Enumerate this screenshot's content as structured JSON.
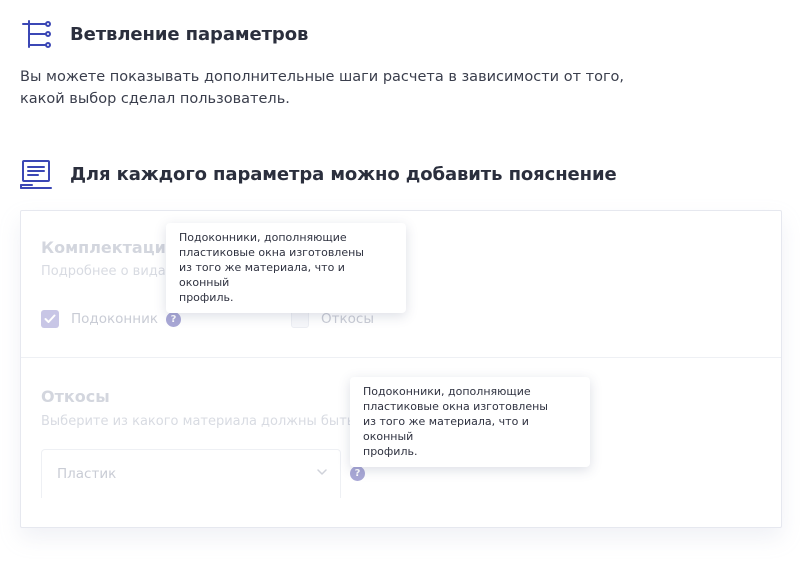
{
  "sections": {
    "branching": {
      "title": "Ветвление параметров",
      "icon": "branch-tree-icon",
      "description_line1": "Вы можете показывать дополнительные шаги расчета в зависимости от того,",
      "description_line2": "какой выбор сделал пользователь."
    },
    "explanation": {
      "title": "Для каждого параметра можно добавить пояснение",
      "icon": "monitor-text-icon"
    }
  },
  "panel": {
    "group1": {
      "title": "Комплектация",
      "subtitle": "Подробнее о вида",
      "options": [
        {
          "label": "Подоконник",
          "checked": true,
          "has_help": true
        },
        {
          "label": "Откосы",
          "checked": false,
          "has_help": false
        }
      ]
    },
    "group2": {
      "title": "Откосы",
      "subtitle": "Выберите из какого материала должны быть",
      "select_value": "Пластик"
    },
    "tooltip1": {
      "line1": "Подоконники, дополняющие",
      "line2": "пластиковые окна изготовлены",
      "line3": "из того же материала, что и оконный",
      "line4": "профиль."
    },
    "tooltip2": {
      "line1": "Подоконники, дополняющие",
      "line2": "пластиковые окна изготовлены",
      "line3": "из того же материала, что и оконный",
      "line4": "профиль."
    },
    "help_glyph": "?"
  },
  "colors": {
    "accent_icon": "#3b47b5",
    "text_dark": "#2b2f3d",
    "help_badge": "#a9a8d6",
    "checkbox_checked": "#c8c6e6"
  }
}
